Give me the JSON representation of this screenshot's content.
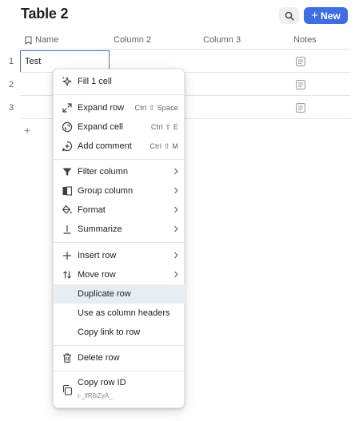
{
  "page": {
    "title": "Table 2"
  },
  "toolbar": {
    "new_label": "New"
  },
  "table": {
    "headers": [
      "Name",
      "Column 2",
      "Column 3",
      "Notes"
    ],
    "rows": [
      {
        "num": "1",
        "name": "Test"
      },
      {
        "num": "2",
        "name": ""
      },
      {
        "num": "3",
        "name": ""
      }
    ],
    "add_row": "+"
  },
  "menu": {
    "fill": "Fill 1 cell",
    "expand_row": {
      "label": "Expand row",
      "shortcut": "Ctrl ⇧ Space"
    },
    "expand_cell": {
      "label": "Expand cell",
      "shortcut": "Ctrl ⇧ E"
    },
    "add_comment": {
      "label": "Add comment",
      "shortcut": "Ctrl ⇧ M"
    },
    "filter_column": "Filter column",
    "group_column": "Group column",
    "format": "Format",
    "summarize": "Summarize",
    "insert_row": "Insert row",
    "move_row": "Move row",
    "duplicate_row": "Duplicate row",
    "use_as_headers": "Use as column headers",
    "copy_link": "Copy link to row",
    "delete_row": "Delete row",
    "copy_row_id": "Copy row ID",
    "row_id": "i-_lfR8iZyA_"
  }
}
